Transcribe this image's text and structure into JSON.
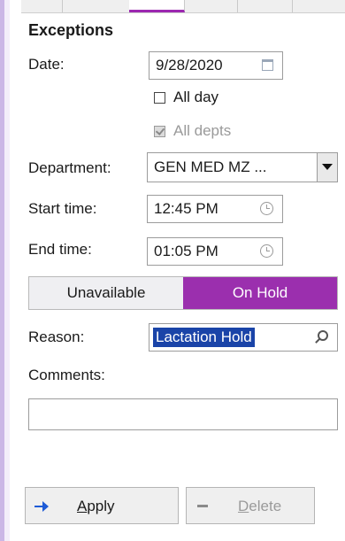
{
  "section": {
    "title": "Exceptions"
  },
  "date": {
    "label": "Date:",
    "value": "9/28/2020"
  },
  "all_day": {
    "label": "All day",
    "checked": false
  },
  "all_depts": {
    "label": "All depts",
    "checked": true,
    "disabled": true
  },
  "department": {
    "label": "Department:",
    "value": "GEN MED MZ ..."
  },
  "start_time": {
    "label": "Start time:",
    "value": "12:45 PM"
  },
  "end_time": {
    "label": "End time:",
    "value": "01:05 PM"
  },
  "status_toggle": {
    "options": [
      "Unavailable",
      "On Hold"
    ],
    "selected": "On Hold",
    "accent_color": "#9b2fae"
  },
  "reason": {
    "label": "Reason:",
    "value": "Lactation Hold"
  },
  "comments": {
    "label": "Comments:",
    "value": ""
  },
  "buttons": {
    "apply": {
      "first": "A",
      "rest": "pply"
    },
    "delete": {
      "first": "D",
      "rest": "elete"
    }
  },
  "icons": {
    "date": "calendar-icon",
    "time": "clock-icon",
    "reason": "search-icon",
    "apply": "arrow-right-icon",
    "delete": "minus-icon"
  }
}
